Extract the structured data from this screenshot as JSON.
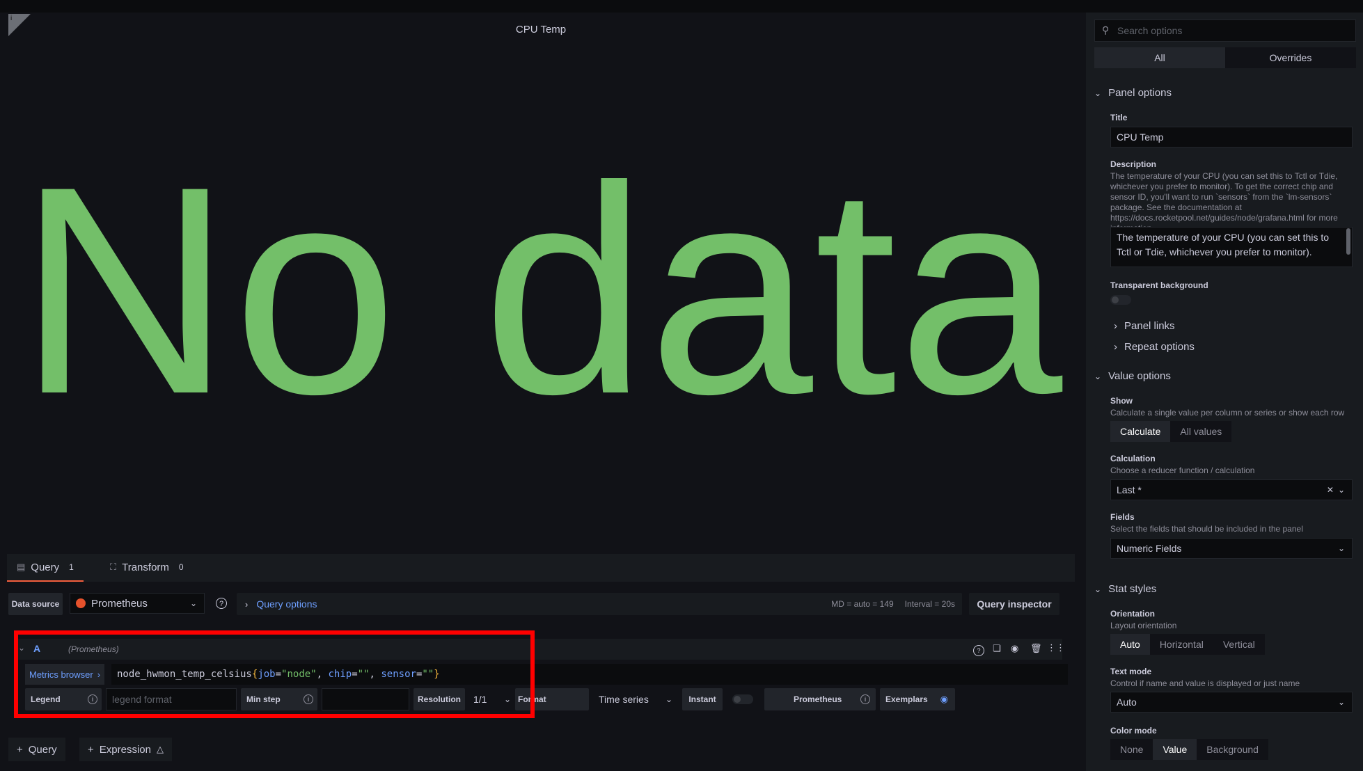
{
  "panel": {
    "title": "CPU Temp",
    "no_data": "No data"
  },
  "query_tabs": [
    {
      "label": "Query",
      "count": "1"
    },
    {
      "label": "Transform",
      "count": "0"
    }
  ],
  "datasource": {
    "label": "Data source",
    "value": "Prometheus",
    "query_options": "Query options",
    "md": "MD = auto = 149",
    "interval": "Interval = 20s",
    "inspector": "Query inspector"
  },
  "query": {
    "ref": "A",
    "source": "(Prometheus)",
    "metrics_browser": "Metrics browser",
    "code": {
      "metric": "node_hwmon_temp_celsius",
      "open": "{",
      "k1": "job",
      "v1": "\"node\"",
      "k2": "chip",
      "v2": "\"\"",
      "k3": "sensor",
      "v3": "\"\"",
      "close": "}",
      "eq": "=",
      "comma": ", "
    },
    "legend_label": "Legend",
    "legend_placeholder": "legend format",
    "min_step_label": "Min step",
    "min_step_value": "",
    "resolution_label": "Resolution",
    "resolution_value": "1/1",
    "format_label": "Format",
    "format_value": "Time series",
    "instant_label": "Instant",
    "prometheus_label": "Prometheus",
    "exemplars_label": "Exemplars"
  },
  "add": {
    "query": "Query",
    "expression": "Expression"
  },
  "options": {
    "search_placeholder": "Search options",
    "tabs": [
      "All",
      "Overrides"
    ],
    "panel_options": {
      "header": "Panel options",
      "title_label": "Title",
      "title_value": "CPU Temp",
      "description_label": "Description",
      "description_help": "The temperature of your CPU (you can set this to Tctl or Tdie, whichever you prefer to monitor). To get the correct chip and sensor ID, you'll want to run `sensors` from the `lm-sensors` package. See the documentation at https://docs.rocketpool.net/guides/node/grafana.html for more information.",
      "description_value": "The temperature of your CPU (you can set this to Tctl or Tdie, whichever you prefer to monitor).",
      "transparent_label": "Transparent background",
      "panel_links": "Panel links",
      "repeat_options": "Repeat options"
    },
    "value_options": {
      "header": "Value options",
      "show_label": "Show",
      "show_desc": "Calculate a single value per column or series or show each row",
      "show_options": [
        "Calculate",
        "All values"
      ],
      "calc_label": "Calculation",
      "calc_desc": "Choose a reducer function / calculation",
      "calc_value": "Last *",
      "fields_label": "Fields",
      "fields_desc": "Select the fields that should be included in the panel",
      "fields_value": "Numeric Fields"
    },
    "stat_styles": {
      "header": "Stat styles",
      "orientation_label": "Orientation",
      "orientation_desc": "Layout orientation",
      "orientation_options": [
        "Auto",
        "Horizontal",
        "Vertical"
      ],
      "text_mode_label": "Text mode",
      "text_mode_desc": "Control if name and value is displayed or just name",
      "text_mode_value": "Auto",
      "color_mode_label": "Color mode",
      "color_mode_options": [
        "None",
        "Value",
        "Background"
      ]
    }
  }
}
